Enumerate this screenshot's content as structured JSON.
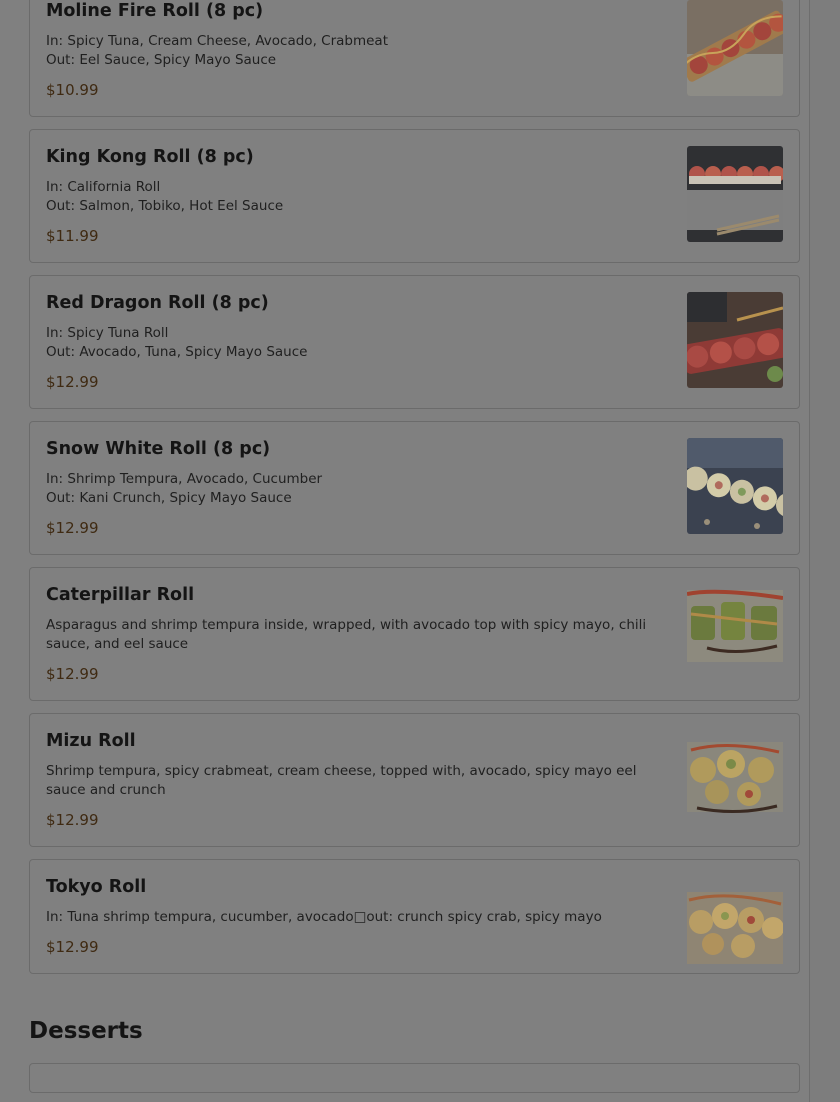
{
  "menu": {
    "items": [
      {
        "name": "Moline Fire Roll (8 pc)",
        "description_lines": [
          "In: Spicy Tuna, Cream Cheese, Avocado, Crabmeat",
          "Out: Eel Sauce, Spicy Mayo Sauce"
        ],
        "price": "$10.99",
        "image_icon": "sushi-roll-photo"
      },
      {
        "name": "King Kong Roll (8 pc)",
        "description_lines": [
          "In: California Roll",
          "Out: Salmon, Tobiko, Hot Eel Sauce"
        ],
        "price": "$11.99",
        "image_icon": "sushi-roll-photo"
      },
      {
        "name": "Red Dragon Roll (8 pc)",
        "description_lines": [
          "In: Spicy Tuna Roll",
          "Out: Avocado, Tuna, Spicy Mayo Sauce"
        ],
        "price": "$12.99",
        "image_icon": "sushi-roll-photo"
      },
      {
        "name": "Snow White Roll (8 pc)",
        "description_lines": [
          "In: Shrimp Tempura, Avocado, Cucumber",
          "Out: Kani Crunch, Spicy Mayo Sauce"
        ],
        "price": "$12.99",
        "image_icon": "sushi-roll-photo"
      },
      {
        "name": "Caterpillar Roll",
        "description_lines": [
          "Asparagus and shrimp tempura inside, wrapped, with avocado top with spicy mayo, chili sauce, and eel sauce"
        ],
        "price": "$12.99",
        "image_icon": "sushi-roll-photo"
      },
      {
        "name": "Mizu Roll",
        "description_lines": [
          "Shrimp tempura, spicy crabmeat, cream cheese, topped with, avocado, spicy mayo eel sauce and crunch"
        ],
        "price": "$12.99",
        "image_icon": "sushi-roll-photo"
      },
      {
        "name": "Tokyo Roll",
        "description_lines": [
          "In: Tuna shrimp tempura, cucumber, avocado□out: crunch spicy crab, spicy mayo"
        ],
        "price": "$12.99",
        "image_icon": "sushi-roll-photo"
      }
    ],
    "next_section_title": "Desserts"
  },
  "colors": {
    "overlay_dim": "#808080",
    "price_text": "#3f2a12"
  }
}
